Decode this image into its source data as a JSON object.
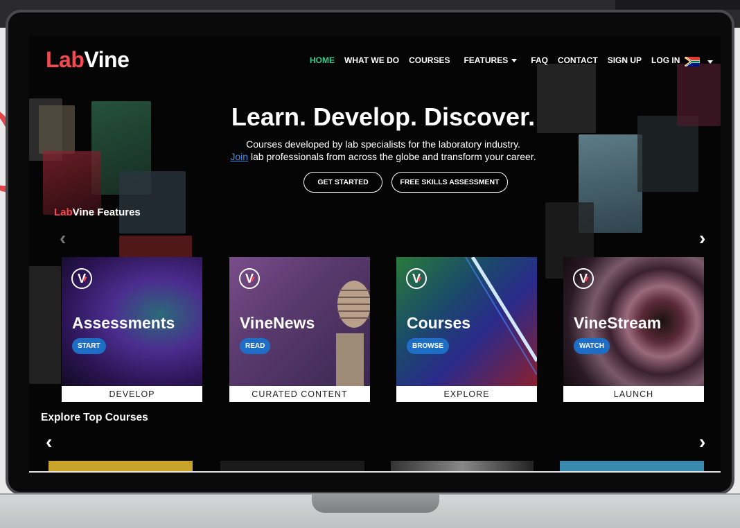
{
  "brand": {
    "lab": "Lab",
    "vine": "Vine"
  },
  "nav": {
    "items": [
      "HOME",
      "WHAT WE DO",
      "COURSES",
      "FEATURES",
      "FAQ",
      "CONTACT",
      "SIGN UP",
      "LOG IN"
    ],
    "active": "HOME"
  },
  "hero": {
    "title": "Learn. Develop. Discover.",
    "subtitle_line1": "Courses developed by lab specialists for the laboratory industry.",
    "join_link": "Join",
    "subtitle_line2_rest": " lab professionals from across the globe and transform your career.",
    "cta_primary": "GET STARTED",
    "cta_secondary": "FREE SKILLS ASSESSMENT"
  },
  "features": {
    "heading_lab": "Lab",
    "heading_vine": "Vine",
    "heading_rest": " Features",
    "cards": [
      {
        "badge": "V",
        "title": "Assessments",
        "action": "START",
        "footer": "DEVELOP"
      },
      {
        "badge": "V",
        "title": "VineNews",
        "action": "READ",
        "footer": "CURATED CONTENT"
      },
      {
        "badge": "V",
        "title": "Courses",
        "action": "BROWSE",
        "footer": "EXPLORE"
      },
      {
        "badge": "V",
        "title": "VineStream",
        "action": "WATCH",
        "footer": "LAUNCH"
      }
    ]
  },
  "explore": {
    "heading": "Explore Top Courses"
  },
  "icons": {
    "prev": "chevron-left-icon",
    "next": "chevron-right-icon",
    "dropdown": "caret-down-icon",
    "language": "south-africa-flag-icon"
  },
  "colors": {
    "brand_red": "#ee4a4f",
    "nav_active": "#3ec98b",
    "pill_blue": "#1f6ec6",
    "link_blue": "#3b8de0"
  }
}
